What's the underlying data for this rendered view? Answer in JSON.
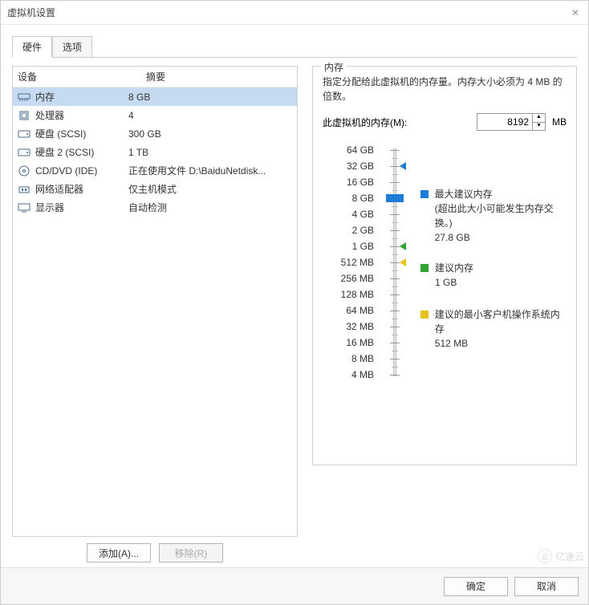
{
  "window": {
    "title": "虚拟机设置",
    "close": "✕"
  },
  "tabs": {
    "hardware": "硬件",
    "options": "选项"
  },
  "device_table": {
    "head_device": "设备",
    "head_summary": "摘要",
    "rows": [
      {
        "icon": "memory-icon",
        "name": "内存",
        "summary": "8 GB",
        "selected": true
      },
      {
        "icon": "cpu-icon",
        "name": "处理器",
        "summary": "4"
      },
      {
        "icon": "disk-icon",
        "name": "硬盘 (SCSI)",
        "summary": "300 GB"
      },
      {
        "icon": "disk-icon",
        "name": "硬盘 2 (SCSI)",
        "summary": "1 TB"
      },
      {
        "icon": "cd-icon",
        "name": "CD/DVD (IDE)",
        "summary": "正在使用文件 D:\\BaiduNetdisk..."
      },
      {
        "icon": "network-icon",
        "name": "网络适配器",
        "summary": "仅主机模式"
      },
      {
        "icon": "display-icon",
        "name": "显示器",
        "summary": "自动检测"
      }
    ]
  },
  "left_buttons": {
    "add": "添加(A)...",
    "remove": "移除(R)"
  },
  "memory_panel": {
    "title": "内存",
    "description": "指定分配给此虚拟机的内存量。内存大小必须为 4 MB 的倍数。",
    "label": "此虚拟机的内存(M):",
    "value": "8192",
    "unit": "MB",
    "ticks": [
      "64 GB",
      "32 GB",
      "16 GB",
      "8 GB",
      "4 GB",
      "2 GB",
      "1 GB",
      "512 MB",
      "256 MB",
      "128 MB",
      "64 MB",
      "32 MB",
      "16 MB",
      "8 MB",
      "4 MB"
    ],
    "legend": {
      "max": {
        "title": "最大建议内存",
        "note": "(超出此大小可能发生内存交换。)",
        "value": "27.8 GB",
        "color": "#1e7bd6"
      },
      "rec": {
        "title": "建议内存",
        "value": "1 GB",
        "color": "#2fa52f"
      },
      "min": {
        "title": "建议的最小客户机操作系统内存",
        "value": "512 MB",
        "color": "#e6c21a"
      }
    }
  },
  "footer": {
    "ok": "确定",
    "cancel": "取消"
  },
  "watermark": "亿速云"
}
